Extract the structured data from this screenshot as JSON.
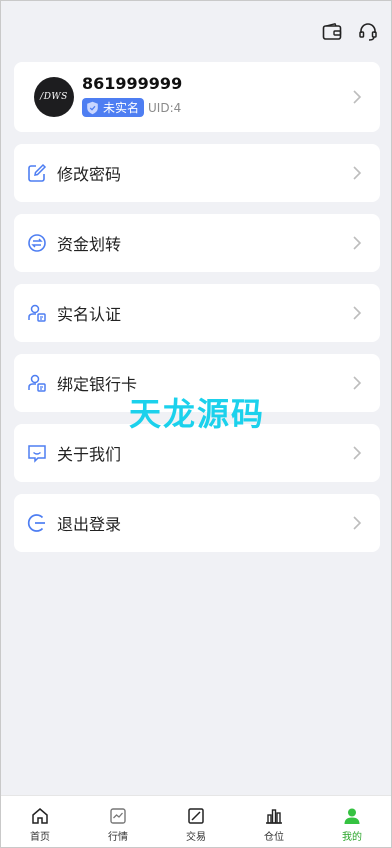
{
  "header": {
    "icons": [
      "wallet-icon",
      "headset-icon"
    ]
  },
  "profile": {
    "avatar_text": "/DWS",
    "username": "861999999",
    "badge_label": "未实名",
    "uid_label": "UID:4"
  },
  "menu": [
    {
      "label": "修改密码",
      "icon": "edit-icon"
    },
    {
      "label": "资金划转",
      "icon": "transfer-icon"
    },
    {
      "label": "实名认证",
      "icon": "id-verify-icon"
    },
    {
      "label": "绑定银行卡",
      "icon": "bank-card-icon"
    },
    {
      "label": "关于我们",
      "icon": "chat-smile-icon"
    },
    {
      "label": "退出登录",
      "icon": "logout-icon"
    }
  ],
  "watermark": "天龙源码",
  "tabs": [
    {
      "label": "首页",
      "icon": "home-icon"
    },
    {
      "label": "行情",
      "icon": "market-icon"
    },
    {
      "label": "交易",
      "icon": "trade-icon"
    },
    {
      "label": "仓位",
      "icon": "position-icon"
    },
    {
      "label": "我的",
      "icon": "user-icon",
      "active": true
    }
  ],
  "colors": {
    "accent": "#4e7ef2",
    "tab_active": "#2aa52a",
    "watermark": "#1bd1ec",
    "background": "#f0f1f5"
  }
}
